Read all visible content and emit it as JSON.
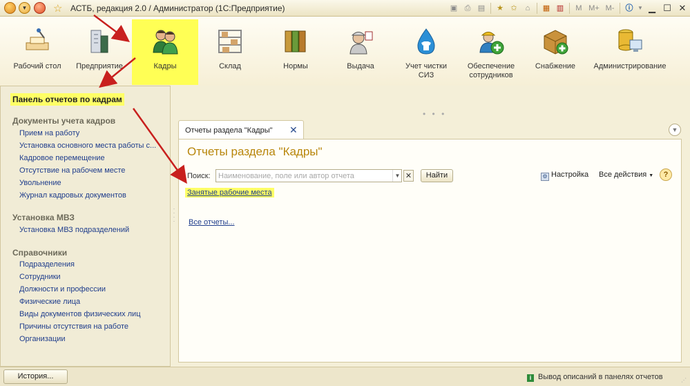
{
  "window": {
    "title": "АСТБ, редакция 2.0 / Администратор  (1С:Предприятие)",
    "toolbar_icons": [
      "save-icon",
      "print-icon",
      "preview-icon",
      "add-favorite-icon",
      "favorites-icon",
      "calculator-icon",
      "calendar-icon"
    ],
    "memory_buttons": [
      "M",
      "M+",
      "M-"
    ],
    "window_controls": [
      "minimize",
      "maximize",
      "close"
    ]
  },
  "sections": [
    {
      "label": "Рабочий стол",
      "icon": "desktop-icon",
      "active": false
    },
    {
      "label": "Предприятие",
      "icon": "building-icon",
      "active": false
    },
    {
      "label": "Кадры",
      "icon": "people-icon",
      "active": true
    },
    {
      "label": "Склад",
      "icon": "warehouse-icon",
      "active": false
    },
    {
      "label": "Нормы",
      "icon": "binders-icon",
      "active": false
    },
    {
      "label": "Выдача",
      "icon": "worker-icon",
      "active": false
    },
    {
      "label": "Учет чистки СИЗ",
      "icon": "drop-shirt-icon",
      "active": false
    },
    {
      "label": "Обеспечение сотрудников",
      "icon": "worker-plus-icon",
      "active": false
    },
    {
      "label": "Снабжение",
      "icon": "box-plus-icon",
      "active": false
    },
    {
      "label": "Администрирование",
      "icon": "database-computer-icon",
      "active": false
    }
  ],
  "left_panel": {
    "title": "Панель отчетов по кадрам",
    "groups": [
      {
        "title": "Документы учета кадров",
        "items": [
          "Прием на работу",
          "Установка основного места работы с...",
          "Кадровое перемещение",
          "Отсутствие на рабочем месте",
          "Увольнение",
          "Журнал кадровых документов"
        ]
      },
      {
        "title": "Установка МВЗ",
        "items": [
          "Установка МВЗ подразделений"
        ]
      },
      {
        "title": "Справочники",
        "items": [
          "Подразделения",
          "Сотрудники",
          "Должности и профессии",
          "Физические лица",
          "Виды документов физических лиц",
          "Причины отсутствия на работе",
          "Организации"
        ]
      }
    ]
  },
  "tab": {
    "label": "Отчеты раздела \"Кадры\"",
    "close": "✕"
  },
  "content": {
    "title": "Отчеты раздела \"Кадры\"",
    "search_label": "Поиск:",
    "search_placeholder": "Наименование, поле или автор отчета",
    "search_value": "",
    "find_button": "Найти",
    "settings_label": "Настройка",
    "all_actions_label": "Все действия",
    "help_label": "?",
    "reports": [
      "Занятые рабочие места"
    ],
    "all_reports_link": "Все отчеты..."
  },
  "status_bar": {
    "history_button": "История...",
    "info_text": "Вывод описаний в панелях отчетов"
  },
  "colors": {
    "highlight": "#ffff55",
    "link": "#1f3d8c",
    "title_accent": "#b8860b",
    "annotation_arrow": "#c8201e"
  }
}
